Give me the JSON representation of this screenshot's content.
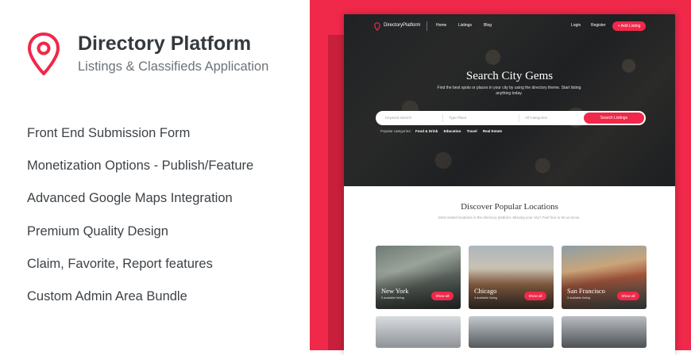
{
  "brand": {
    "title": "Directory Platform",
    "subtitle": "Listings & Classifieds Application",
    "accent": "#f0284a"
  },
  "features": [
    "Front End Submission Form",
    "Monetization Options - Publish/Feature",
    "Advanced Google Maps Integration",
    "Premium Quality Design",
    "Claim, Favorite, Report features",
    "Custom Admin Area Bundle"
  ],
  "preview": {
    "nav": {
      "brand": "DirectoryPlatform",
      "links": [
        "Home",
        "Listings",
        "Blog"
      ],
      "login": "Login",
      "register": "Register",
      "add_listing": "+ Add Listing"
    },
    "hero": {
      "title": "Search City Gems",
      "description": "Find the best spots or places in your city by using the directory theme. Start listing anything today.",
      "search": {
        "keyword": "Keyword Search",
        "place": "Type Place",
        "category": "All Categories",
        "button": "Search Listings"
      },
      "categories_label": "Popular categories:",
      "categories": [
        "Food & Drink",
        "Education",
        "Travel",
        "Real Estate"
      ]
    },
    "locations": {
      "title": "Discover Popular Locations",
      "description": "Most visited locations in the directory platform. Missing your city? Feel free to let us know.",
      "cards": [
        {
          "name": "New York",
          "count": "5 available listing",
          "button": "Show all"
        },
        {
          "name": "Chicago",
          "count": "4 available listing",
          "button": "Show all"
        },
        {
          "name": "San Francisco",
          "count": "3 available listing",
          "button": "Show all"
        }
      ]
    }
  }
}
